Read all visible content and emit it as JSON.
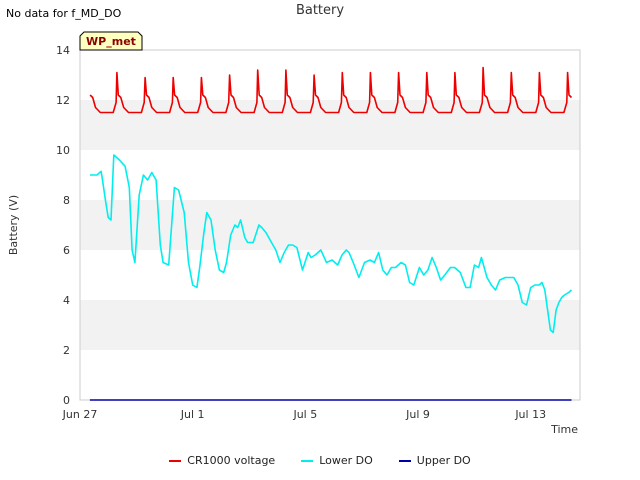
{
  "header": {
    "no_data_text": "No data for f_MD_DO",
    "title": "Battery"
  },
  "colors": {
    "cr1000": "#ee0000",
    "lower_do": "#00eeee",
    "upper_do": "#0000aa",
    "band": "#f2f2f2",
    "station_tag_fill": "#ffffc0",
    "station_tag_text": "#8b0000"
  },
  "chart_data": {
    "type": "line",
    "title": "Battery",
    "xlabel": "Time",
    "ylabel": "Battery (V)",
    "station_tag": "WP_met",
    "xlim": [
      0,
      17.75
    ],
    "ylim": [
      0,
      14
    ],
    "x_unit": "days since Jun 27",
    "x_ticks": [
      {
        "value": 0,
        "label": "Jun 27"
      },
      {
        "value": 4,
        "label": "Jul 1"
      },
      {
        "value": 8,
        "label": "Jul 5"
      },
      {
        "value": 12,
        "label": "Jul 9"
      },
      {
        "value": 16,
        "label": "Jul 13"
      }
    ],
    "y_ticks": [
      0,
      2,
      4,
      6,
      8,
      10,
      12,
      14
    ],
    "grid": "horizontal alternating bands",
    "legend_position": "bottom-center",
    "series": [
      {
        "name": "CR1000 voltage",
        "color": "#ee0000",
        "pattern": "daily",
        "daily_points": [
          [
            0.0,
            11.5
          ],
          [
            0.18,
            11.5
          ],
          [
            0.28,
            11.9
          ],
          [
            0.31,
            13.0
          ],
          [
            0.36,
            12.2
          ],
          [
            0.45,
            12.1
          ],
          [
            0.55,
            11.7
          ],
          [
            0.72,
            11.5
          ],
          [
            0.95,
            11.5
          ]
        ],
        "peaks": [
          13.1,
          13.1,
          12.9,
          12.9,
          12.9,
          13.0,
          13.2,
          13.2,
          13.0,
          13.1,
          13.1,
          13.1,
          13.1,
          13.1,
          13.3,
          13.1,
          13.1,
          13.1
        ],
        "first_x": 0.35,
        "last_x": 17.45
      },
      {
        "name": "Lower DO",
        "color": "#00eeee",
        "x": [
          0.35,
          0.6,
          0.75,
          0.8,
          0.9,
          1.0,
          1.1,
          1.2,
          1.4,
          1.6,
          1.75,
          1.85,
          1.95,
          2.1,
          2.25,
          2.4,
          2.55,
          2.7,
          2.85,
          2.95,
          3.15,
          3.35,
          3.5,
          3.7,
          3.85,
          4.0,
          4.15,
          4.25,
          4.4,
          4.5,
          4.65,
          4.8,
          4.95,
          5.1,
          5.2,
          5.35,
          5.5,
          5.6,
          5.7,
          5.85,
          5.95,
          6.15,
          6.35,
          6.45,
          6.6,
          6.8,
          6.95,
          7.1,
          7.25,
          7.4,
          7.55,
          7.7,
          7.9,
          8.1,
          8.2,
          8.35,
          8.55,
          8.75,
          8.95,
          9.15,
          9.3,
          9.45,
          9.55,
          9.7,
          9.9,
          10.1,
          10.3,
          10.45,
          10.6,
          10.75,
          10.9,
          11.05,
          11.2,
          11.4,
          11.55,
          11.7,
          11.85,
          12.05,
          12.2,
          12.35,
          12.5,
          12.65,
          12.8,
          12.95,
          13.15,
          13.3,
          13.5,
          13.7,
          13.85,
          14.0,
          14.15,
          14.25,
          14.45,
          14.6,
          14.75,
          14.9,
          15.1,
          15.25,
          15.4,
          15.55,
          15.7,
          15.85,
          16.0,
          16.15,
          16.3,
          16.4,
          16.5,
          16.6,
          16.7,
          16.8,
          16.9,
          17.0,
          17.1,
          17.2,
          17.35,
          17.45
        ],
        "values": [
          9.0,
          9.0,
          9.15,
          8.8,
          8.0,
          7.3,
          7.2,
          9.8,
          9.6,
          9.35,
          8.5,
          6.0,
          5.5,
          8.2,
          9.0,
          8.8,
          9.1,
          8.8,
          6.2,
          5.5,
          5.4,
          8.5,
          8.4,
          7.5,
          5.5,
          4.6,
          4.5,
          5.3,
          6.7,
          7.5,
          7.2,
          6.0,
          5.2,
          5.1,
          5.5,
          6.6,
          7.0,
          6.9,
          7.2,
          6.5,
          6.3,
          6.3,
          7.0,
          6.9,
          6.7,
          6.3,
          6.0,
          5.5,
          5.9,
          6.2,
          6.2,
          6.1,
          5.2,
          5.9,
          5.7,
          5.8,
          6.0,
          5.5,
          5.6,
          5.4,
          5.8,
          6.0,
          5.9,
          5.5,
          4.9,
          5.5,
          5.6,
          5.5,
          5.9,
          5.2,
          5.0,
          5.3,
          5.3,
          5.5,
          5.4,
          4.7,
          4.6,
          5.3,
          5.0,
          5.2,
          5.7,
          5.3,
          4.8,
          5.0,
          5.3,
          5.3,
          5.1,
          4.5,
          4.5,
          5.4,
          5.3,
          5.7,
          4.9,
          4.6,
          4.4,
          4.8,
          4.9,
          4.9,
          4.9,
          4.6,
          3.9,
          3.8,
          4.5,
          4.6,
          4.6,
          4.7,
          4.4,
          3.6,
          2.8,
          2.7,
          3.6,
          3.9,
          4.1,
          4.2,
          4.3,
          4.4
        ]
      },
      {
        "name": "Upper DO",
        "color": "#0000aa",
        "x": [
          0.35,
          17.45
        ],
        "values": [
          0,
          0
        ]
      }
    ]
  }
}
